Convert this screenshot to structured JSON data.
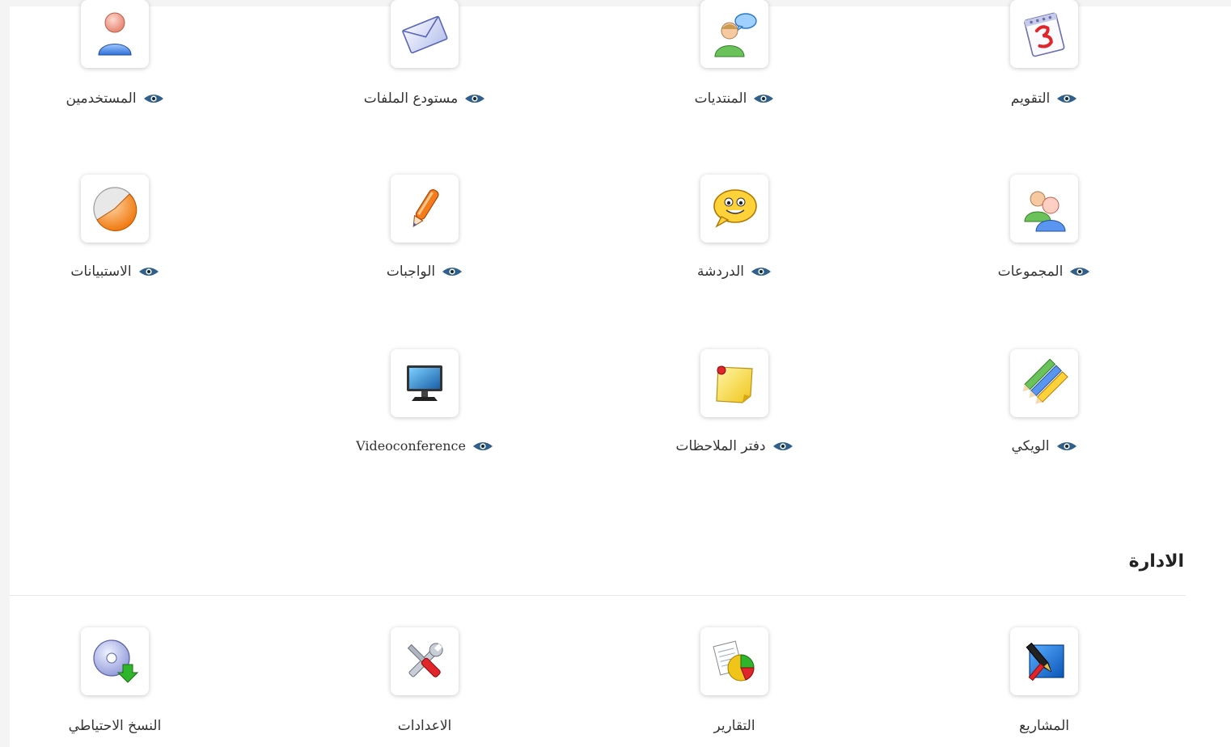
{
  "tools": {
    "users": {
      "label": "المستخدمين",
      "icon": "user-icon"
    },
    "documents": {
      "label": "مستودع الملفات",
      "icon": "envelope-icon"
    },
    "forums": {
      "label": "المنتديات",
      "icon": "forum-icon"
    },
    "calendar": {
      "label": "التقويم",
      "icon": "calendar-icon"
    },
    "surveys": {
      "label": "الاستبيانات",
      "icon": "survey-pie-icon"
    },
    "assignments": {
      "label": "الواجبات",
      "icon": "pen-icon"
    },
    "chat": {
      "label": "الدردشة",
      "icon": "chat-smiley-icon"
    },
    "groups": {
      "label": "المجموعات",
      "icon": "groups-icon"
    },
    "videoconference": {
      "label": "Videoconference",
      "icon": "monitor-icon"
    },
    "notebook": {
      "label": "دفتر الملاحظات",
      "icon": "sticky-note-icon"
    },
    "wiki": {
      "label": "الويكي",
      "icon": "pencils-icon"
    }
  },
  "admin": {
    "title": "الادارة",
    "backup": {
      "label": "النسخ الاحتياطي",
      "icon": "backup-disc-icon"
    },
    "settings": {
      "label": "الاعدادات",
      "icon": "tools-icon"
    },
    "reports": {
      "label": "التقارير",
      "icon": "reports-icon"
    },
    "projects": {
      "label": "المشاريع",
      "icon": "projects-icon"
    }
  },
  "colors": {
    "page_bg": "#f4f4f4",
    "panel_bg": "#ffffff",
    "text": "#333333"
  }
}
